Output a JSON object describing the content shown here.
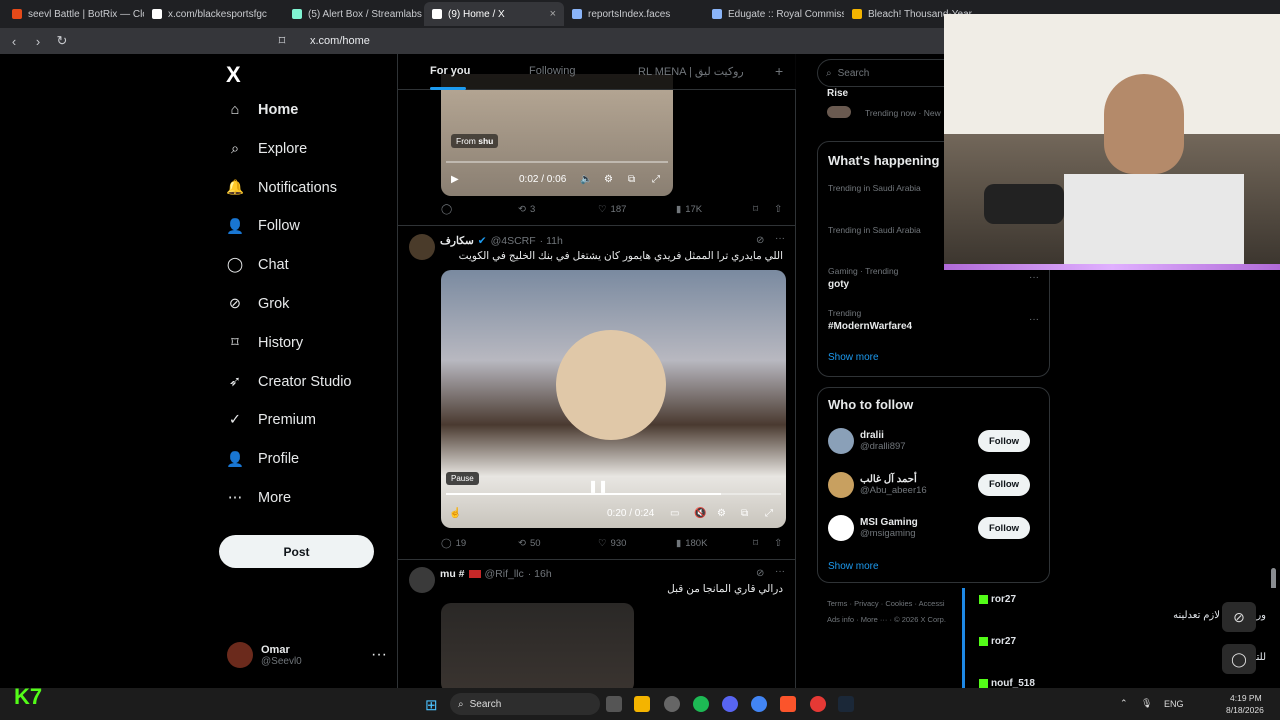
{
  "browser": {
    "tabs": [
      {
        "title": "seevl Battle | BotRix — Cloud",
        "color": "#e64a19"
      },
      {
        "title": "x.com/blackesportsfgc",
        "color": "#ffffff"
      },
      {
        "title": "(5) Alert Box / Streamlabs",
        "color": "#80f5d2"
      },
      {
        "title": "(9) Home / X",
        "color": "#ffffff",
        "active": true
      },
      {
        "title": "reportsIndex.faces",
        "color": "#8ab4f8"
      },
      {
        "title": "Edugate :: Royal Commission",
        "color": "#8ab4f8"
      },
      {
        "title": "Bleach! Thousand-Year",
        "color": "#f4b400"
      }
    ],
    "tab_close": "×",
    "url": "x.com/home"
  },
  "nav": {
    "logo": "X",
    "items": [
      {
        "label": "Home",
        "icon": "home-icon"
      },
      {
        "label": "Explore",
        "icon": "search-icon"
      },
      {
        "label": "Notifications",
        "icon": "bell-icon"
      },
      {
        "label": "Follow",
        "icon": "add-user-icon"
      },
      {
        "label": "Chat",
        "icon": "chat-icon"
      },
      {
        "label": "Grok",
        "icon": "grok-icon"
      },
      {
        "label": "History",
        "icon": "bookmark-icon"
      },
      {
        "label": "Creator Studio",
        "icon": "rocket-icon"
      },
      {
        "label": "Premium",
        "icon": "verified-icon"
      },
      {
        "label": "Profile",
        "icon": "profile-icon"
      },
      {
        "label": "More",
        "icon": "more-icon"
      }
    ],
    "post_label": "Post",
    "account": {
      "name": "Omar",
      "handle": "@Seevl0"
    }
  },
  "feed": {
    "tabs": [
      "For you",
      "Following",
      "RL MENA | روكيت ليق"
    ],
    "add_tab": "+",
    "post1": {
      "from_label": "From",
      "from_name": "shu",
      "time": "0:02 / 0:06",
      "replies": "",
      "reposts": "3",
      "likes": "187",
      "views": "17K"
    },
    "post2": {
      "name": "سكارف",
      "handle": "@4SCRF",
      "time": "· 11h",
      "text": "اللي مايدري ترا الممثل فريدي هايمور كان يشتغل في بنك الخليج في الكويت",
      "pause_tooltip": "Pause",
      "video_time": "0:20 / 0:24",
      "replies": "19",
      "reposts": "50",
      "likes": "930",
      "views": "180K"
    },
    "post3": {
      "name": "mu #",
      "handle": "@Rif_llc",
      "time": "· 16h",
      "text": "درالي قاري المانجا من قبل"
    }
  },
  "right": {
    "search_placeholder": "Search",
    "rise": {
      "title": "Rise",
      "meta": "Trending now · New"
    },
    "happening_title": "What's happening",
    "trends": [
      {
        "meta": "Trending in Saudi Arabia",
        "name": ""
      },
      {
        "meta": "Trending in Saudi Arabia",
        "name": ""
      },
      {
        "meta": "Gaming · Trending",
        "name": "goty"
      },
      {
        "meta": "Trending",
        "name": "#ModernWarfare4"
      }
    ],
    "show_more": "Show more",
    "who_title": "Who to follow",
    "who": [
      {
        "name": "dralii",
        "handle": "@dralli897",
        "color": "#8aa0b8"
      },
      {
        "name": "أحمد آل غالب",
        "handle": "@Abu_abeer16",
        "color": "#c8a060"
      },
      {
        "name": "MSI Gaming",
        "handle": "@msigaming",
        "color": "#ffffff"
      }
    ],
    "follow_label": "Follow",
    "footer_line1": "Terms · Privacy · Cookies · Accessi",
    "footer_line2": "Ads info · More ··· · © 2026 X Corp."
  },
  "overlay": {
    "chat": [
      {
        "user": "ror27",
        "msg": "وراك صوم لازم تعدلينه"
      },
      {
        "user": "ror27",
        "msg": "للتذكير"
      },
      {
        "user": "nouf_518",
        "msg": ""
      }
    ],
    "kick_logo": "K7"
  },
  "taskbar": {
    "search_placeholder": "Search",
    "lang": "ENG",
    "time": "4:19 PM",
    "date": "8/18/2026"
  }
}
